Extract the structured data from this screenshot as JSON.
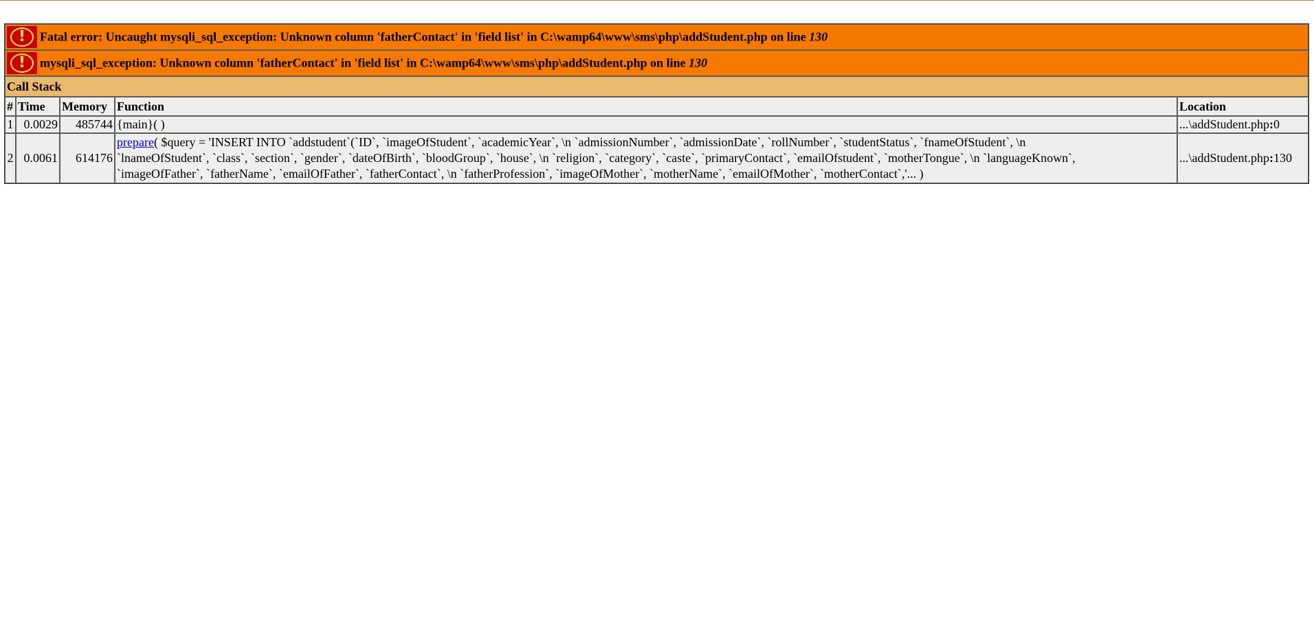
{
  "error": {
    "icon": "warning-exclamation-icon",
    "fatal_prefix": "Fatal error: Uncaught mysqli_sql_exception: Unknown column 'fatherContact' in 'field list' in C:\\wamp64\\www\\sms\\php\\addStudent.php on line ",
    "fatal_line": "130",
    "exception_text": "mysqli_sql_exception: Unknown column 'fatherContact' in 'field list' in C:\\wamp64\\www\\sms\\php\\addStudent.php on line ",
    "exception_line": "130",
    "colors": {
      "error_row": "#f57900",
      "callstack_header": "#e9b96e",
      "cell_bg": "#eeeeec",
      "icon_bg": "#cc0000",
      "icon_fg": "#fce94f"
    }
  },
  "call_stack": {
    "title": "Call Stack",
    "headers": {
      "index": "#",
      "time": "Time",
      "memory": "Memory",
      "function": "Function",
      "location": "Location"
    },
    "rows": [
      {
        "index": "1",
        "time": "0.0029",
        "memory": "485744",
        "function": "{main}( )",
        "location_file": "...\\addStudent.php",
        "location_sep": ":",
        "location_line": "0"
      },
      {
        "index": "2",
        "time": "0.0061",
        "memory": "614176",
        "function_link": "prepare",
        "function_args_1": "( $query = 'INSERT INTO `addstudent`(`ID`, `imageOfStudent`, `academicYear`, \\n `admissionNumber`, `admissionDate`, `rollNumber`, `studentStatus`, `fnameOfStudent`, \\n",
        "function_args_2": "`lnameOfStudent`, `class`, `section`, `gender`, `dateOfBirth`, `bloodGroup`, `house`, \\n `religion`, `category`, `caste`, `primaryContact`, `emailOfstudent`, `motherTongue`, \\n `languageKnown`,",
        "function_args_3": "`imageOfFather`, `fatherName`, `emailOfFather`, `fatherContact`, \\n `fatherProfession`, `imageOfMother`, `motherName`, `emailOfMother`, `motherContact`,'... )",
        "location_file": "...\\addStudent.php",
        "location_sep": ":",
        "location_line": "130"
      }
    ]
  }
}
